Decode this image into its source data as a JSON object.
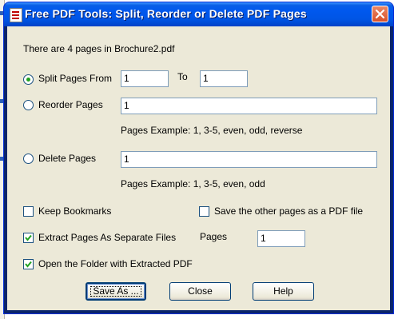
{
  "window": {
    "title": "Free PDF Tools: Split, Reorder or Delete PDF Pages"
  },
  "info": {
    "text": "There are 4 pages in Brochure2.pdf"
  },
  "split": {
    "label": "Split Pages From",
    "from_value": "1",
    "to_label": "To",
    "to_value": "1",
    "selected": true
  },
  "reorder": {
    "label": "Reorder Pages",
    "value": "1",
    "example": "Pages Example: 1, 3-5, even, odd, reverse",
    "selected": false
  },
  "delete": {
    "label": "Delete Pages",
    "value": "1",
    "example": "Pages Example: 1, 3-5, even, odd",
    "selected": false
  },
  "options": {
    "keep_bookmarks": {
      "label": "Keep Bookmarks",
      "checked": false
    },
    "save_other": {
      "label": "Save the other pages as a PDF file",
      "checked": false
    },
    "extract_separate": {
      "label": "Extract Pages As Separate Files",
      "checked": true
    },
    "pages_label": "Pages",
    "pages_value": "1",
    "open_folder": {
      "label": "Open the Folder with Extracted PDF",
      "checked": true
    }
  },
  "buttons": {
    "save_as": "Save As ...",
    "close": "Close",
    "help": "Help"
  },
  "colors": {
    "titlebar": "#0058ee",
    "dialog_bg": "#ece9d8",
    "radio_dot": "#21a121",
    "check_mark": "#21a121"
  },
  "icons": {
    "close": "close-x-icon",
    "app": "pdf-app-icon",
    "radio": "radio-dot-icon",
    "check": "checkmark-icon"
  }
}
